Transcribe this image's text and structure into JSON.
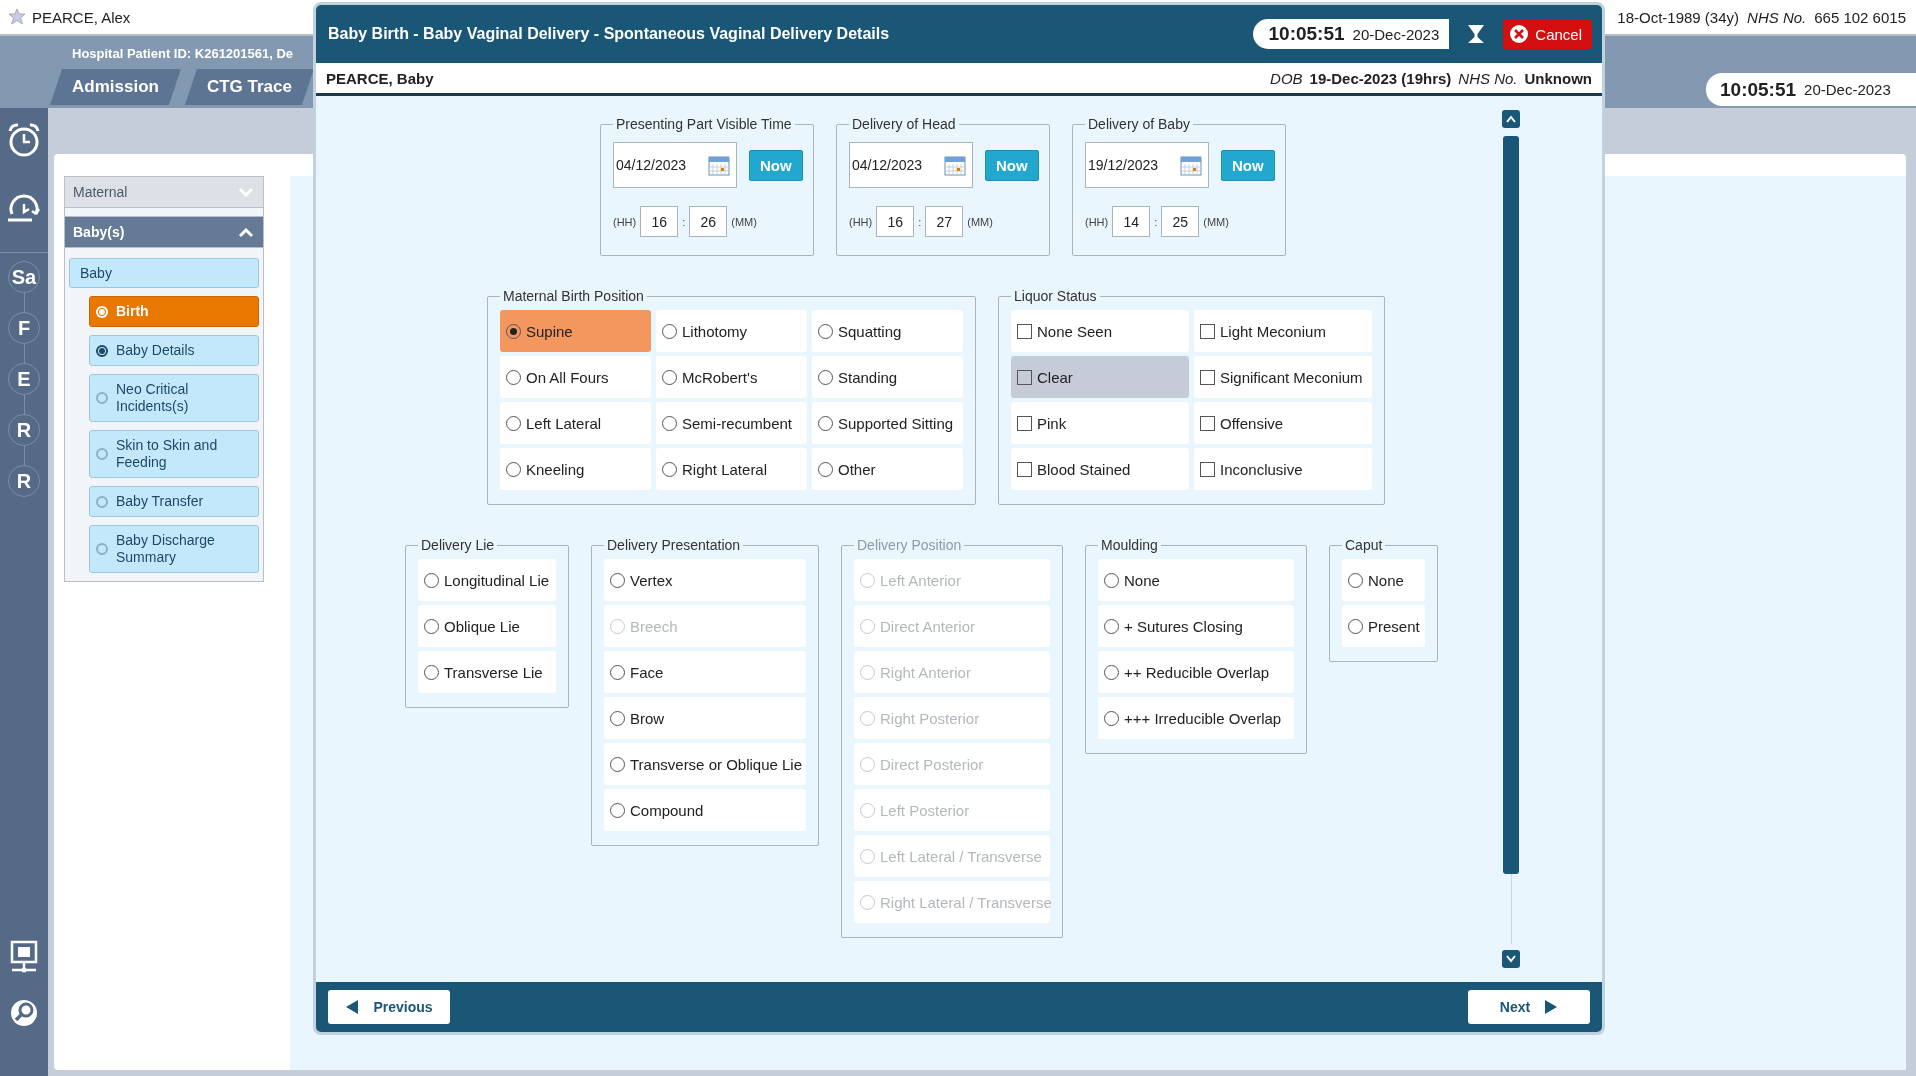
{
  "app": {
    "patient_name": "PEARCE, Alex",
    "patient_dob": "18-Oct-1989 (34y)",
    "nhs_label": "NHS No.",
    "nhs_number": "665 102 6015",
    "hospital_id": "Hospital Patient ID: K261201561, De",
    "tabs": [
      {
        "label": "Admission"
      },
      {
        "label": "CTG Trace"
      }
    ],
    "clock": {
      "time": "10:05:51",
      "date": "20-Dec-2023"
    },
    "rail_steps": [
      "Sa",
      "F",
      "E",
      "R",
      "R"
    ]
  },
  "sidebar": {
    "sections": [
      {
        "label": "Maternal",
        "expanded": false
      },
      {
        "label": "Baby(s)",
        "expanded": true,
        "children": [
          {
            "label": "Baby",
            "children": [
              {
                "label": "Birth",
                "selected": true,
                "checked": true
              },
              {
                "label": "Baby Details",
                "selected": false,
                "checked": true
              },
              {
                "label": "Neo Critical Incidents(s)",
                "selected": false,
                "checked": false
              },
              {
                "label": "Skin to Skin and Feeding",
                "selected": false,
                "checked": false
              },
              {
                "label": "Baby Transfer",
                "selected": false,
                "checked": false
              },
              {
                "label": "Baby Discharge Summary",
                "selected": false,
                "checked": false
              }
            ]
          }
        ]
      }
    ]
  },
  "dialog": {
    "title": "Baby Birth - Baby Vaginal Delivery - Spontaneous Vaginal Delivery Details",
    "clock": {
      "time": "10:05:51",
      "date": "20-Dec-2023"
    },
    "cancel": "Cancel",
    "patient": {
      "name": "PEARCE, Baby",
      "dob_label": "DOB",
      "dob": "19-Dec-2023 (19hrs)",
      "nhs_label": "NHS No.",
      "nhs": "Unknown"
    },
    "time_groups": [
      {
        "legend": "Presenting Part Visible Time",
        "date": "04/12/2023",
        "now": "Now",
        "hh_label": "(HH)",
        "hh": "16",
        "separator": ":",
        "mm": "26",
        "mm_label": "(MM)"
      },
      {
        "legend": "Delivery of Head",
        "date": "04/12/2023",
        "now": "Now",
        "hh_label": "(HH)",
        "hh": "16",
        "separator": ":",
        "mm": "27",
        "mm_label": "(MM)"
      },
      {
        "legend": "Delivery of Baby",
        "date": "19/12/2023",
        "now": "Now",
        "hh_label": "(HH)",
        "hh": "14",
        "separator": ":",
        "mm": "25",
        "mm_label": "(MM)"
      }
    ],
    "option_rows": [
      [
        {
          "legend": "Maternal Birth Position",
          "kind": "radio",
          "disabled": false,
          "options": [
            {
              "label": "Supine",
              "selected": true,
              "disabled": false
            },
            {
              "label": "Lithotomy",
              "selected": false,
              "disabled": false
            },
            {
              "label": "Squatting",
              "selected": false,
              "disabled": false
            },
            {
              "label": "On All Fours",
              "selected": false,
              "disabled": false
            },
            {
              "label": "McRobert's",
              "selected": false,
              "disabled": false
            },
            {
              "label": "Standing",
              "selected": false,
              "disabled": false
            },
            {
              "label": "Left Lateral",
              "selected": false,
              "disabled": false
            },
            {
              "label": "Semi-recumbent",
              "selected": false,
              "disabled": false
            },
            {
              "label": "Supported Sitting",
              "selected": false,
              "disabled": false
            },
            {
              "label": "Kneeling",
              "selected": false,
              "disabled": false
            },
            {
              "label": "Right Lateral",
              "selected": false,
              "disabled": false
            },
            {
              "label": "Other",
              "selected": false,
              "disabled": false
            }
          ]
        },
        {
          "legend": "Liquor Status",
          "kind": "checkbox",
          "disabled": false,
          "options": [
            {
              "label": "None Seen",
              "checked": false,
              "highlighted": false
            },
            {
              "label": "Light Meconium",
              "checked": false,
              "highlighted": false
            },
            {
              "label": "Clear",
              "checked": false,
              "highlighted": true
            },
            {
              "label": "Significant Meconium",
              "checked": false,
              "highlighted": false
            },
            {
              "label": "Pink",
              "checked": false,
              "highlighted": false
            },
            {
              "label": "Offensive",
              "checked": false,
              "highlighted": false
            },
            {
              "label": "Blood Stained",
              "checked": false,
              "highlighted": false
            },
            {
              "label": "Inconclusive",
              "checked": false,
              "highlighted": false
            }
          ]
        }
      ],
      [
        {
          "legend": "Delivery Lie",
          "kind": "radio",
          "disabled": false,
          "options": [
            {
              "label": "Longitudinal Lie",
              "selected": false,
              "disabled": false
            },
            {
              "label": "Oblique Lie",
              "selected": false,
              "disabled": false
            },
            {
              "label": "Transverse Lie",
              "selected": false,
              "disabled": false
            }
          ]
        },
        {
          "legend": "Delivery Presentation",
          "kind": "radio",
          "disabled": false,
          "options": [
            {
              "label": "Vertex",
              "selected": false,
              "disabled": false
            },
            {
              "label": "Breech",
              "selected": false,
              "disabled": true
            },
            {
              "label": "Face",
              "selected": false,
              "disabled": false
            },
            {
              "label": "Brow",
              "selected": false,
              "disabled": false
            },
            {
              "label": "Transverse or Oblique Lie",
              "selected": false,
              "disabled": false
            },
            {
              "label": "Compound",
              "selected": false,
              "disabled": false
            }
          ]
        },
        {
          "legend": "Delivery Position",
          "kind": "radio",
          "disabled": true,
          "options": [
            {
              "label": "Left Anterior",
              "selected": false,
              "disabled": true
            },
            {
              "label": "Direct Anterior",
              "selected": false,
              "disabled": true
            },
            {
              "label": "Right Anterior",
              "selected": false,
              "disabled": true
            },
            {
              "label": "Right Posterior",
              "selected": false,
              "disabled": true
            },
            {
              "label": "Direct Posterior",
              "selected": false,
              "disabled": true
            },
            {
              "label": "Left Posterior",
              "selected": false,
              "disabled": true
            },
            {
              "label": "Left Lateral / Transverse",
              "selected": false,
              "disabled": true
            },
            {
              "label": "Right Lateral / Transverse",
              "selected": false,
              "disabled": true
            }
          ]
        },
        {
          "legend": "Moulding",
          "kind": "radio",
          "disabled": false,
          "options": [
            {
              "label": "None",
              "selected": false,
              "disabled": false
            },
            {
              "label": "+ Sutures Closing",
              "selected": false,
              "disabled": false
            },
            {
              "label": "++ Reducible Overlap",
              "selected": false,
              "disabled": false
            },
            {
              "label": "+++ Irreducible Overlap",
              "selected": false,
              "disabled": false
            }
          ]
        },
        {
          "legend": "Caput",
          "kind": "radio",
          "disabled": false,
          "options": [
            {
              "label": "None",
              "selected": false,
              "disabled": false
            },
            {
              "label": "Present",
              "selected": false,
              "disabled": false
            }
          ]
        }
      ]
    ],
    "previous": "Previous",
    "next": "Next"
  }
}
